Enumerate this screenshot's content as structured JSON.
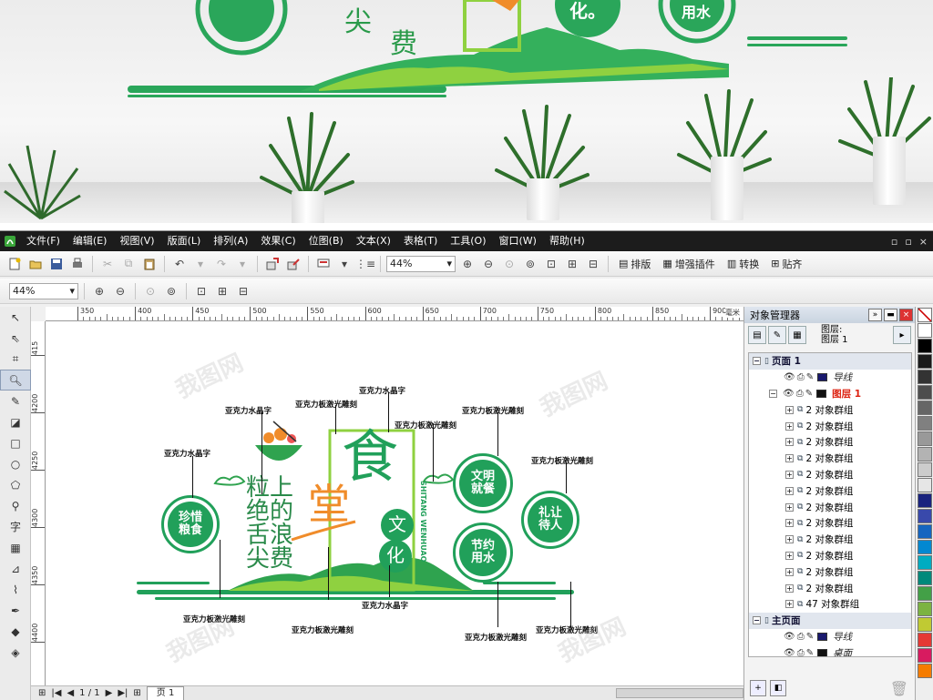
{
  "photo": {
    "wall_texts": [
      "尖",
      "费",
      "化。",
      "用水"
    ]
  },
  "menu": [
    "文件(F)",
    "编辑(E)",
    "视图(V)",
    "版面(L)",
    "排列(A)",
    "效果(C)",
    "位图(B)",
    "文本(X)",
    "表格(T)",
    "工具(O)",
    "窗口(W)",
    "帮助(H)"
  ],
  "window_controls": [
    "▫",
    "▫",
    "×"
  ],
  "toolbar1": {
    "zoom": "44%",
    "tools": [
      "排版",
      "增强插件",
      "转换",
      "贴齐"
    ]
  },
  "toolbar2": {
    "zoom": "44%"
  },
  "ruler": {
    "h_ticks": [
      "350",
      "400",
      "450",
      "500",
      "550",
      "600",
      "650",
      "700",
      "750",
      "800",
      "850",
      "900"
    ],
    "h_unit": "毫米",
    "v_ticks": [
      "415",
      "4200",
      "4250",
      "4300",
      "4350",
      "4400"
    ]
  },
  "status": {
    "page_counter": "1 / 1",
    "page_tab": "页 1"
  },
  "docker": {
    "title": "对象管理器",
    "info_line1": "图层:",
    "info_line2": "图层 1",
    "rows": [
      {
        "kind": "section",
        "label": "页面 1"
      },
      {
        "kind": "layer",
        "label": "导线",
        "color": "#1a1a6e"
      },
      {
        "kind": "layer",
        "label": "图层 1",
        "color": "#111111",
        "active": true
      },
      {
        "kind": "group",
        "label": "2 对象群组"
      },
      {
        "kind": "group",
        "label": "2 对象群组"
      },
      {
        "kind": "group",
        "label": "2 对象群组"
      },
      {
        "kind": "group",
        "label": "2 对象群组"
      },
      {
        "kind": "group",
        "label": "2 对象群组"
      },
      {
        "kind": "group",
        "label": "2 对象群组"
      },
      {
        "kind": "group",
        "label": "2 对象群组"
      },
      {
        "kind": "group",
        "label": "2 对象群组"
      },
      {
        "kind": "group",
        "label": "2 对象群组"
      },
      {
        "kind": "group",
        "label": "2 对象群组"
      },
      {
        "kind": "group",
        "label": "2 对象群组"
      },
      {
        "kind": "group",
        "label": "2 对象群组"
      },
      {
        "kind": "group",
        "label": "47 对象群组"
      },
      {
        "kind": "section",
        "label": "主页面"
      },
      {
        "kind": "layer",
        "label": "导线",
        "color": "#1a1a6e"
      },
      {
        "kind": "layer",
        "label": "桌面",
        "color": "#111111"
      },
      {
        "kind": "layer",
        "label": "网格",
        "color": "#bbbbbb"
      }
    ]
  },
  "palette": [
    "#ffffff",
    "#000000",
    "#1a1a1a",
    "#333333",
    "#4d4d4d",
    "#666666",
    "#808080",
    "#999999",
    "#b3b3b3",
    "#cccccc",
    "#e6e6e6",
    "#1a237e",
    "#3949ab",
    "#1565c0",
    "#0288d1",
    "#00acc1",
    "#00897b",
    "#43a047",
    "#7cb342",
    "#c0ca33",
    "#e53935",
    "#d81b60",
    "#f57c00"
  ],
  "design": {
    "labels": {
      "l1": "亚克力水晶字",
      "l2": "亚克力水晶字",
      "l3": "亚克力板激光雕刻",
      "l4": "亚克力水晶字",
      "l5": "亚克力板激光雕刻",
      "l6": "亚克力板激光雕刻",
      "l7": "亚克力板激光雕刻",
      "l8": "亚克力板激光雕刻",
      "l9": "亚克力板激光雕刻",
      "l10": "亚克力水晶字",
      "l11": "亚克力板激光雕刻",
      "l12": "亚克力板激光雕刻"
    },
    "title_big": "食",
    "title_sub": "堂",
    "culture1": "文",
    "culture2": "化",
    "pinyin": "SHITANG WENHUAO",
    "poem": [
      "粒上",
      "绝的",
      "舌浪",
      "尖费"
    ],
    "circle1": [
      "珍惜",
      "粮食"
    ],
    "circle2": [
      "文明",
      "就餐"
    ],
    "circle3": [
      "节约",
      "用水"
    ],
    "circle4": [
      "礼让",
      "待人"
    ]
  },
  "watermark": "我图网"
}
